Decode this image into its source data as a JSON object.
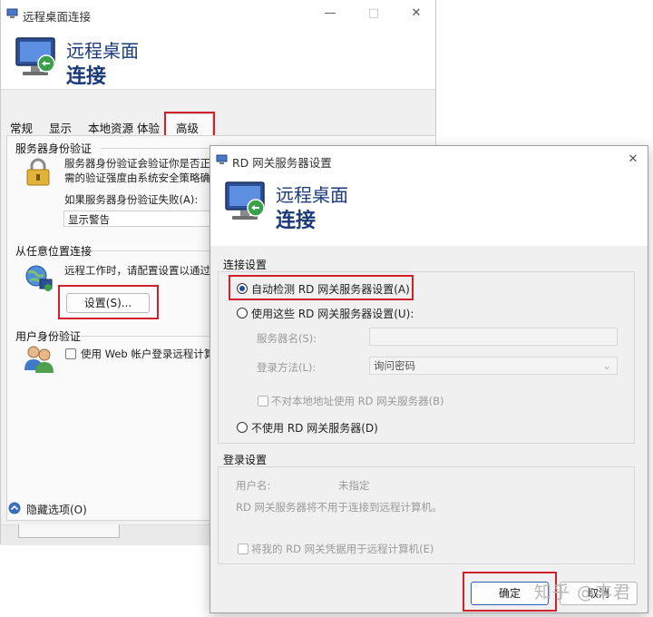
{
  "back_window": {
    "title": "远程桌面连接",
    "header_line1": "远程桌面",
    "header_line2": "连接",
    "tabs": [
      "常规",
      "显示",
      "本地资源",
      "体验",
      "高级"
    ],
    "server_auth": {
      "group_title": "服务器身份验证",
      "desc_line1": "服务器身份验证会验证你是否正在连",
      "desc_line2": "需的验证强度由系统安全策略确定。",
      "fail_label": "如果服务器身份验证失败(A):",
      "fail_value": "显示警告"
    },
    "connect_anywhere": {
      "group_title": "从任意位置连接",
      "desc": "远程工作时，请配置设置以通过远程",
      "settings_button": "设置(S)..."
    },
    "user_auth": {
      "group_title": "用户身份验证",
      "checkbox_label": "使用 Web 帐户登录远程计算机"
    },
    "hide_options": "隐藏选项(O)"
  },
  "rd_dialog": {
    "title": "RD 网关服务器设置",
    "header_line1": "远程桌面",
    "header_line2": "连接",
    "connection_settings": {
      "group_title": "连接设置",
      "option_auto": "自动检测 RD 网关服务器设置(A)",
      "option_use": "使用这些 RD 网关服务器设置(U):",
      "server_name_label": "服务器名(S):",
      "login_method_label": "登录方法(L):",
      "login_method_value": "询问密码",
      "bypass_local_label": "不对本地地址使用 RD 网关服务器(B)",
      "option_none": "不使用 RD 网关服务器(D)"
    },
    "login_settings": {
      "group_title": "登录设置",
      "username_label": "用户名:",
      "username_value": "未指定",
      "note": "RD 网关服务器将不用于连接到远程计算机。",
      "use_credentials_label": "将我的 RD 网关凭据用于远程计算机(E)"
    },
    "ok_button": "确定",
    "cancel_button": "取消"
  },
  "watermark": "知乎 @丰君",
  "colors": {
    "accent_text": "#1a3a7a",
    "highlight_box": "#d0202a"
  }
}
